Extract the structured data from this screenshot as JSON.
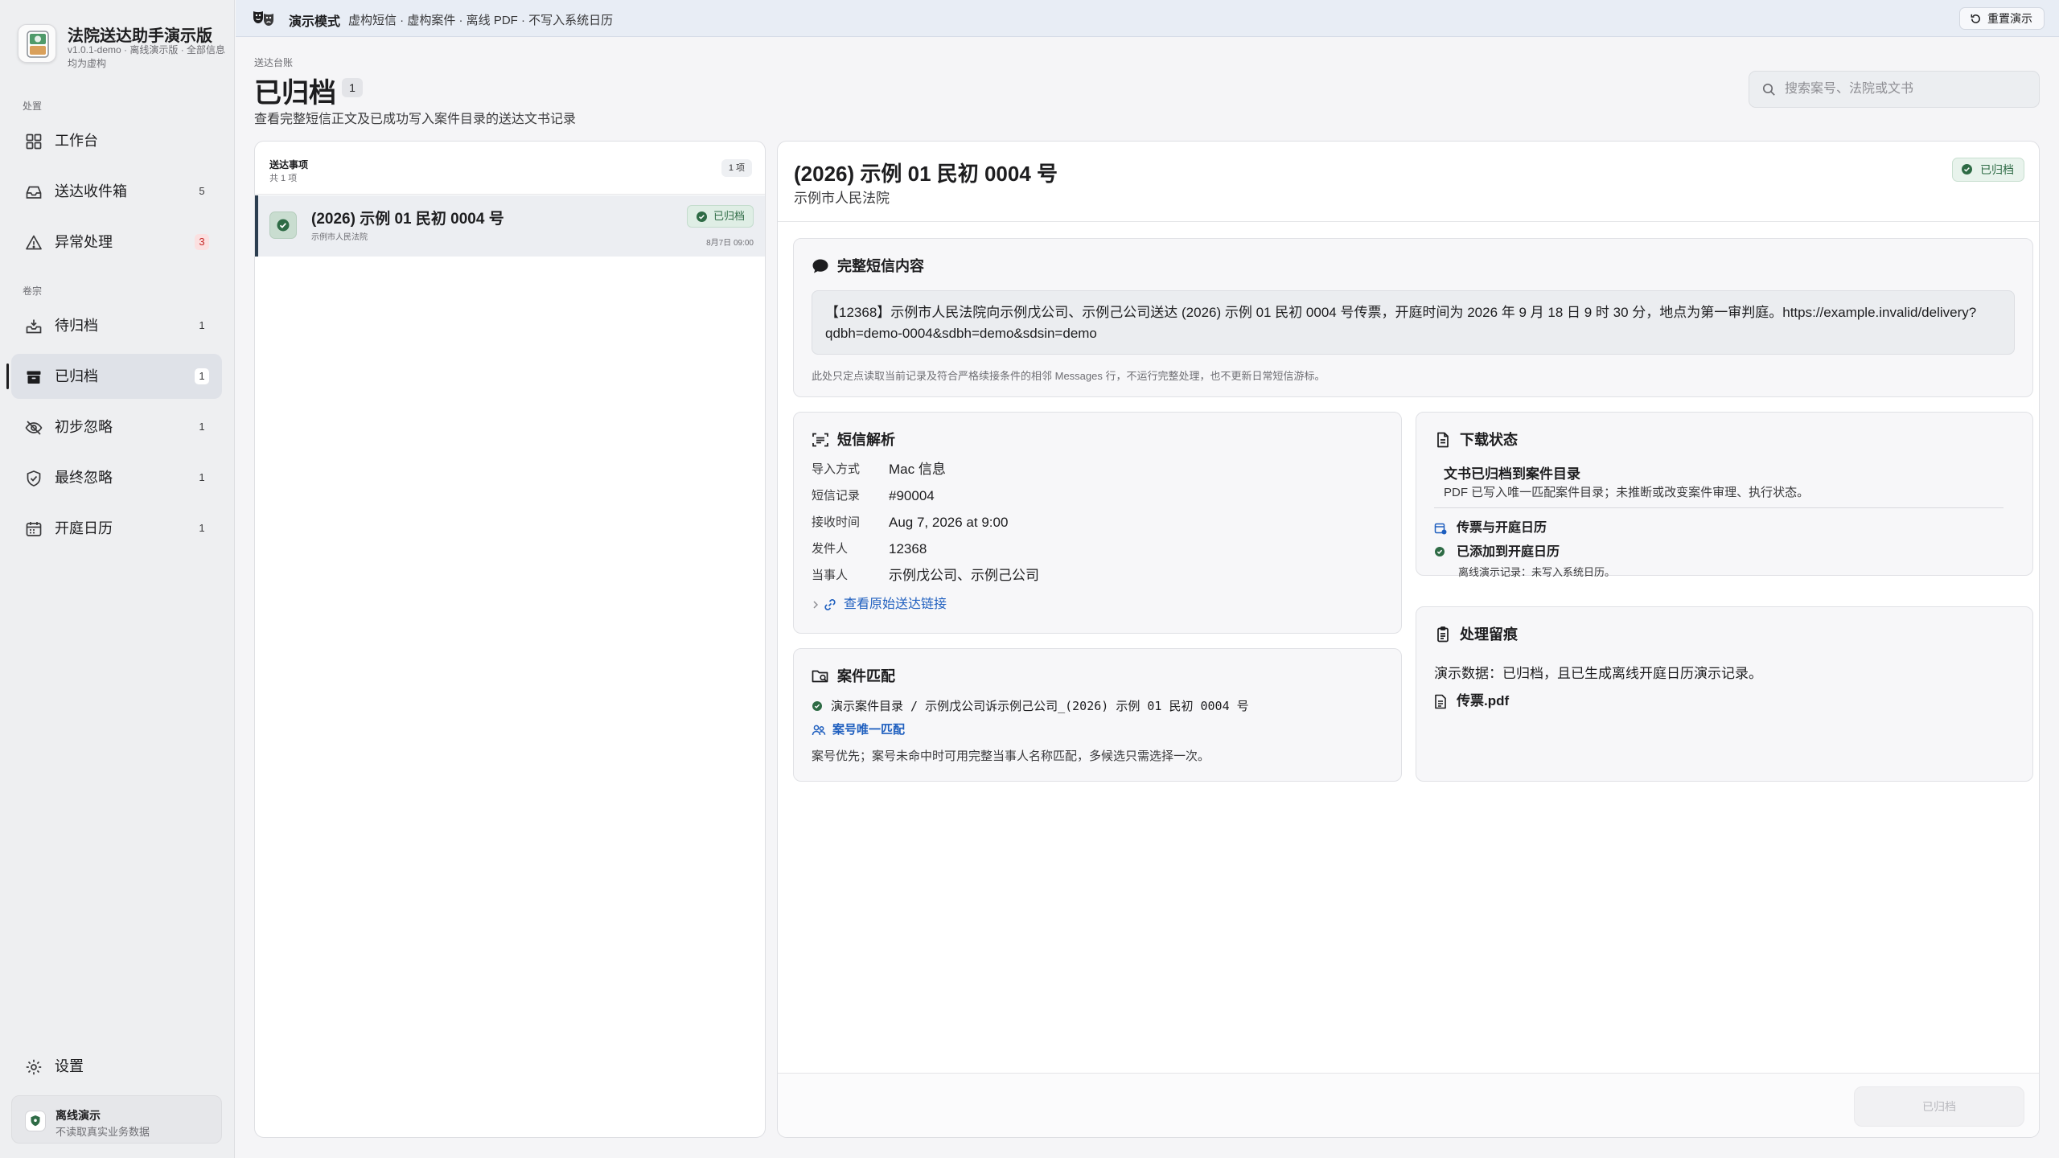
{
  "app": {
    "name": "法院送达助手演示版",
    "subtitle": "v1.0.1-demo · 离线演示版 · 全部信息均为虚构"
  },
  "sidebar": {
    "sections": [
      {
        "label": "处置"
      },
      {
        "label": "卷宗"
      }
    ],
    "items": [
      {
        "label": "工作台",
        "count": "",
        "icon": "dashboard-icon"
      },
      {
        "label": "送达收件箱",
        "count": "5",
        "icon": "inbox-icon"
      },
      {
        "label": "异常处理",
        "count": "3",
        "icon": "warning-icon"
      },
      {
        "label": "待归档",
        "count": "1",
        "icon": "tray-icon"
      },
      {
        "label": "已归档",
        "count": "1",
        "icon": "archive-box-icon",
        "active": true
      },
      {
        "label": "初步忽略",
        "count": "1",
        "icon": "eye-slash-icon"
      },
      {
        "label": "最终忽略",
        "count": "1",
        "icon": "shield-check-icon"
      },
      {
        "label": "开庭日历",
        "count": "1",
        "icon": "calendar-icon"
      }
    ],
    "settings_label": "设置",
    "offline": {
      "title": "离线演示",
      "subtitle": "不读取真实业务数据"
    }
  },
  "banner": {
    "title": "演示模式",
    "description": "虚构短信 · 虚构案件 · 离线 PDF · 不写入系统日历",
    "reset_label": "重置演示"
  },
  "header": {
    "breadcrumb": "送达台账",
    "title": "已归档",
    "count": "1",
    "subtitle": "查看完整短信正文及已成功写入案件目录的送达文书记录"
  },
  "search": {
    "placeholder": "搜索案号、法院或文书",
    "value": ""
  },
  "list": {
    "title": "送达事项",
    "total": "共 1 项",
    "badge": "1 项",
    "rows": [
      {
        "title": "(2026) 示例 01 民初 0004 号",
        "court": "示例市人民法院",
        "status": "已归档",
        "time": "8月7日 09:00"
      }
    ]
  },
  "detail": {
    "title": "(2026) 示例 01 民初 0004 号",
    "court": "示例市人民法院",
    "status": "已归档",
    "sms": {
      "title": "完整短信内容",
      "content": "【12368】示例市人民法院向示例戊公司、示例己公司送达 (2026) 示例 01 民初 0004 号传票，开庭时间为 2026 年 9 月 18 日 9 时 30 分，地点为第一审判庭。https://example.invalid/delivery?qdbh=demo-0004&sdbh=demo&sdsin=demo",
      "note": "此处只定点读取当前记录及符合严格续接条件的相邻 Messages 行，不运行完整处理，也不更新日常短信游标。"
    },
    "parse": {
      "title": "短信解析",
      "fields": [
        {
          "key": "导入方式",
          "value": "Mac 信息"
        },
        {
          "key": "短信记录",
          "value": "#90004"
        },
        {
          "key": "接收时间",
          "value": "Aug 7, 2026 at 9:00"
        },
        {
          "key": "发件人",
          "value": "12368"
        },
        {
          "key": "当事人",
          "value": "示例戊公司、示例己公司"
        }
      ],
      "link_label": "查看原始送达链接"
    },
    "download": {
      "title": "下载状态",
      "headline": "文书已归档到案件目录",
      "description": "PDF 已写入唯一匹配案件目录；未推断或改变案件审理、执行状态。",
      "item1": "传票与开庭日历",
      "item2": "已添加到开庭日历",
      "item2_sub": "离线演示记录：未写入系统日历。"
    },
    "match": {
      "title": "案件匹配",
      "path": "演示案件目录 / 示例戊公司诉示例己公司_(2026) 示例 01 民初 0004 号",
      "tag": "案号唯一匹配",
      "note": "案号优先；案号未命中时可用完整当事人名称匹配，多候选只需选择一次。"
    },
    "trace": {
      "title": "处理留痕",
      "text": "演示数据：已归档，且已生成离线开庭日历演示记录。",
      "file": "传票.pdf"
    },
    "footer_button": "已归档"
  },
  "colors": {
    "accent": "#1f5fbf",
    "success": "#2e6b45",
    "alert": "#c62828",
    "sidebar_bg": "#eeeff1",
    "banner_bg": "#e8edf5"
  }
}
